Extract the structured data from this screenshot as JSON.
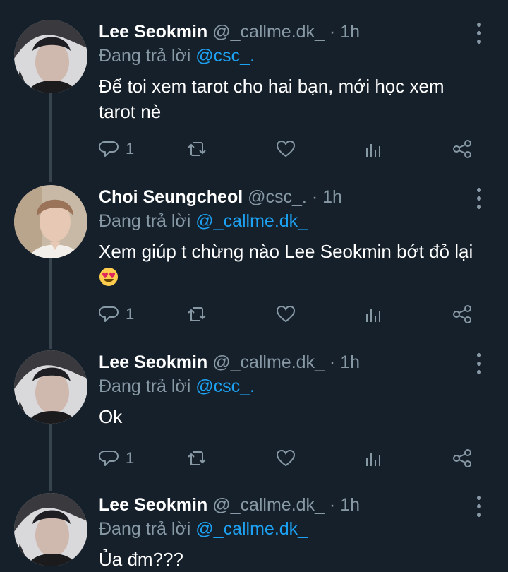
{
  "tweets": [
    {
      "name": "Lee Seokmin",
      "handle": "@_callme.dk_",
      "dot": "·",
      "time": "1h",
      "replying_to_label": "Đang trả lời",
      "replying_to": "@csc_.",
      "text": "Để toi xem tarot cho hai bạn, mới học xem tarot nè",
      "reply_count": "1"
    },
    {
      "name": "Choi Seungcheol",
      "handle": "@csc_.",
      "dot": "·",
      "time": "1h",
      "replying_to_label": "Đang trả lời",
      "replying_to": "@_callme.dk_",
      "text": "Xem giúp t chừng nào Lee Seokmin bớt đỏ lại",
      "emoji": "smiling-face-with-heart-eyes",
      "reply_count": "1"
    },
    {
      "name": "Lee Seokmin",
      "handle": "@_callme.dk_",
      "dot": "·",
      "time": "1h",
      "replying_to_label": "Đang trả lời",
      "replying_to": "@csc_.",
      "text": "Ok",
      "reply_count": "1"
    },
    {
      "name": "Lee Seokmin",
      "handle": "@_callme.dk_",
      "dot": "·",
      "time": "1h",
      "replying_to_label": "Đang trả lời",
      "replying_to": "@_callme.dk_",
      "text": "Ủa đm???"
    }
  ],
  "colors": {
    "background": "#15202b",
    "secondary_text": "#8899a6",
    "mention": "#1da1f2",
    "thread_line": "#38444d"
  },
  "icons": [
    "reply-icon",
    "retweet-icon",
    "like-icon",
    "analytics-icon",
    "share-icon",
    "more-options-icon"
  ]
}
